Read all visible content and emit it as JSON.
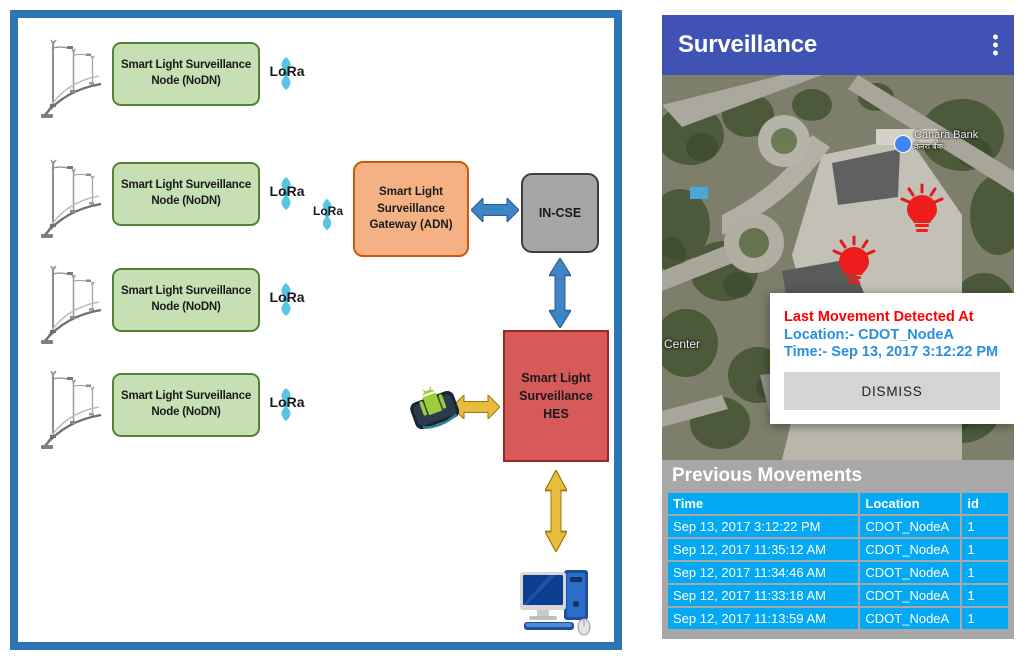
{
  "diagram": {
    "nodes": [
      {
        "label": "Smart Light Surveillance Node (NoDN)",
        "radio": "LoRa"
      },
      {
        "label": "Smart Light Surveillance Node (NoDN)",
        "radio": "LoRa"
      },
      {
        "label": "Smart Light Surveillance Node (NoDN)",
        "radio": "LoRa"
      },
      {
        "label": "Smart Light Surveillance Node (NoDN)",
        "radio": "LoRa"
      }
    ],
    "gateway": {
      "label": "Smart Light Surveillance Gateway (ADN)",
      "radio": "LoRa"
    },
    "in_cse": {
      "label": "IN-CSE"
    },
    "hes": {
      "label": "Smart Light Surveillance HES"
    },
    "phone_icon": "android-phone-icon",
    "pc_icon": "desktop-computer-icon",
    "colors": {
      "frame": "#2e75b6",
      "node_fill": "#c6e0b4",
      "node_border": "#548235",
      "gateway_fill": "#f4b183",
      "gateway_border": "#c55a11",
      "incse_fill": "#a6a6a6",
      "incse_border": "#3f3f3f",
      "hes_fill": "#d75a5a",
      "hes_border": "#a02622",
      "arrow_blue": "#2e75b6",
      "arrow_gold": "#bf8f00"
    }
  },
  "app": {
    "title": "Surveillance",
    "overflow_icon": "three-dots-vertical-icon",
    "app_bar_color": "#4053b5",
    "map": {
      "poi_label": "Canara Bank",
      "poi_label_secondary": "कैनरा बैंक",
      "poi_label_2": "Center",
      "marker_icon": "red-light-bulb-marker"
    },
    "dialog": {
      "title": "Last Movement Detected At",
      "location": "Location:- CDOT_NodeA",
      "time": "Time:- Sep 13, 2017 3:12:22 PM",
      "dismiss_label": "DISMISS",
      "title_color": "#ff0000",
      "text_color": "#2a8fe0"
    },
    "table": {
      "heading": "Previous Movements",
      "columns": [
        "Time",
        "Location",
        "id"
      ],
      "rows": [
        [
          "Sep 13, 2017 3:12:22 PM",
          "CDOT_NodeA",
          "1"
        ],
        [
          "Sep 12, 2017 11:35:12 AM",
          "CDOT_NodeA",
          "1"
        ],
        [
          "Sep 12, 2017 11:34:46 AM",
          "CDOT_NodeA",
          "1"
        ],
        [
          "Sep 12, 2017 11:33:18 AM",
          "CDOT_NodeA",
          "1"
        ],
        [
          "Sep 12, 2017 11:13:59 AM",
          "CDOT_NodeA",
          "1"
        ]
      ],
      "header_color": "#03a9f4",
      "block_color": "#a8a8a8"
    }
  }
}
